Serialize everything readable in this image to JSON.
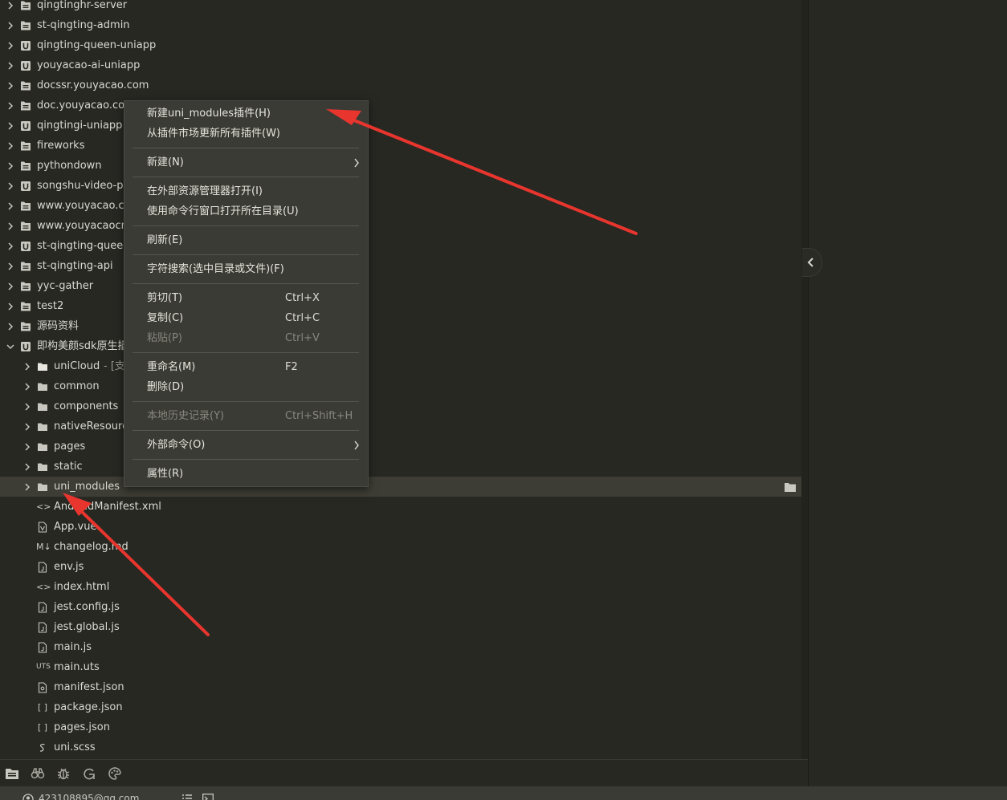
{
  "tree": {
    "items": [
      {
        "label": "qingtinghr-server",
        "icon": "project-icon",
        "level": 0,
        "chevron": "right"
      },
      {
        "label": "st-qingting-admin",
        "icon": "project-icon",
        "level": 0,
        "chevron": "right"
      },
      {
        "label": "qingting-queen-uniapp",
        "icon": "uniapp-project-icon",
        "level": 0,
        "chevron": "right"
      },
      {
        "label": "youyacao-ai-uniapp",
        "icon": "uniapp-project-icon",
        "level": 0,
        "chevron": "right"
      },
      {
        "label": "docssr.youyacao.com",
        "icon": "project-icon",
        "level": 0,
        "chevron": "right"
      },
      {
        "label": "doc.youyacao.com",
        "icon": "project-icon",
        "level": 0,
        "chevron": "right"
      },
      {
        "label": "qingtingi-uniapp",
        "icon": "uniapp-project-icon",
        "level": 0,
        "chevron": "right"
      },
      {
        "label": "fireworks",
        "icon": "project-icon",
        "level": 0,
        "chevron": "right"
      },
      {
        "label": "pythondown",
        "icon": "project-icon",
        "level": 0,
        "chevron": "right"
      },
      {
        "label": "songshu-video-pag",
        "icon": "uniapp-project-icon",
        "level": 0,
        "chevron": "right"
      },
      {
        "label": "www.youyacao.cn_2",
        "icon": "project-icon",
        "level": 0,
        "chevron": "right"
      },
      {
        "label": "www.youyacaocn",
        "icon": "project-icon",
        "level": 0,
        "chevron": "right"
      },
      {
        "label": "st-qingting-queen-",
        "icon": "uniapp-project-icon",
        "level": 0,
        "chevron": "right"
      },
      {
        "label": "st-qingting-api",
        "icon": "project-icon",
        "level": 0,
        "chevron": "right"
      },
      {
        "label": "yyc-gather",
        "icon": "project-icon",
        "level": 0,
        "chevron": "right"
      },
      {
        "label": "test2",
        "icon": "project-icon",
        "level": 0,
        "chevron": "right"
      },
      {
        "label": "源码资料",
        "icon": "project-icon",
        "level": 0,
        "chevron": "right"
      },
      {
        "label": "即构美颜sdk原生插件",
        "icon": "uniapp-project-icon",
        "level": 0,
        "chevron": "down"
      },
      {
        "label": "uniCloud",
        "sub": " - [支付",
        "icon": "cloud-folder-icon",
        "level": 1,
        "chevron": "right"
      },
      {
        "label": "common",
        "icon": "folder-icon",
        "level": 1,
        "chevron": "right"
      },
      {
        "label": "components",
        "icon": "folder-icon",
        "level": 1,
        "chevron": "right"
      },
      {
        "label": "nativeResource",
        "icon": "folder-icon",
        "level": 1,
        "chevron": "right"
      },
      {
        "label": "pages",
        "icon": "folder-icon",
        "level": 1,
        "chevron": "right"
      },
      {
        "label": "static",
        "icon": "folder-icon",
        "level": 1,
        "chevron": "right"
      },
      {
        "label": "uni_modules",
        "icon": "folder-icon",
        "level": 1,
        "chevron": "right",
        "selected": true
      },
      {
        "label": "AndroidManifest.xml",
        "icon": "code-file-icon",
        "level": 1
      },
      {
        "label": "App.vue",
        "icon": "vue-file-icon",
        "level": 1
      },
      {
        "label": "changelog.md",
        "icon": "markdown-file-icon",
        "level": 1
      },
      {
        "label": "env.js",
        "icon": "js-file-icon",
        "level": 1
      },
      {
        "label": "index.html",
        "icon": "code-file-icon",
        "level": 1
      },
      {
        "label": "jest.config.js",
        "icon": "js-file-icon",
        "level": 1
      },
      {
        "label": "jest.global.js",
        "icon": "js-file-icon",
        "level": 1
      },
      {
        "label": "main.js",
        "icon": "js-file-icon",
        "level": 1
      },
      {
        "label": "main.uts",
        "icon": "uts-file-icon",
        "level": 1
      },
      {
        "label": "manifest.json",
        "icon": "manifest-file-icon",
        "level": 1
      },
      {
        "label": "package.json",
        "icon": "json-file-icon",
        "level": 1
      },
      {
        "label": "pages.json",
        "icon": "json-file-icon",
        "level": 1
      },
      {
        "label": "uni.scss",
        "icon": "scss-file-icon",
        "level": 1
      }
    ],
    "uts_glyph": "UTS",
    "json_glyph": "[ ]",
    "code_glyph": "<>",
    "md_glyph": "M↓"
  },
  "context_menu": {
    "items": [
      {
        "type": "item",
        "label": "新建uni_modules插件(H)",
        "name": "menu-new-uni-modules-plugin"
      },
      {
        "type": "item",
        "label": "从插件市场更新所有插件(W)",
        "name": "menu-update-all-plugins"
      },
      {
        "type": "sep"
      },
      {
        "type": "item",
        "label": "新建(N)",
        "name": "menu-new",
        "submenu": true
      },
      {
        "type": "sep"
      },
      {
        "type": "item",
        "label": "在外部资源管理器打开(I)",
        "name": "menu-open-in-explorer"
      },
      {
        "type": "item",
        "label": "使用命令行窗口打开所在目录(U)",
        "name": "menu-open-in-terminal"
      },
      {
        "type": "sep"
      },
      {
        "type": "item",
        "label": "刷新(E)",
        "name": "menu-refresh"
      },
      {
        "type": "sep"
      },
      {
        "type": "item",
        "label": "字符搜索(选中目录或文件)(F)",
        "name": "menu-text-search"
      },
      {
        "type": "sep"
      },
      {
        "type": "item",
        "label": "剪切(T)",
        "shortcut": "Ctrl+X",
        "name": "menu-cut"
      },
      {
        "type": "item",
        "label": "复制(C)",
        "shortcut": "Ctrl+C",
        "name": "menu-copy"
      },
      {
        "type": "item",
        "label": "粘贴(P)",
        "shortcut": "Ctrl+V",
        "name": "menu-paste",
        "disabled": true
      },
      {
        "type": "sep"
      },
      {
        "type": "item",
        "label": "重命名(M)",
        "shortcut": "F2",
        "name": "menu-rename"
      },
      {
        "type": "item",
        "label": "删除(D)",
        "name": "menu-delete"
      },
      {
        "type": "sep"
      },
      {
        "type": "item",
        "label": "本地历史记录(Y)",
        "shortcut": "Ctrl+Shift+H",
        "name": "menu-local-history",
        "disabled": true
      },
      {
        "type": "sep"
      },
      {
        "type": "item",
        "label": "外部命令(O)",
        "name": "menu-external-commands",
        "submenu": true
      },
      {
        "type": "sep"
      },
      {
        "type": "item",
        "label": "属性(R)",
        "name": "menu-properties"
      }
    ]
  },
  "status": {
    "account": "423108895@qq.com"
  },
  "toolbar": {
    "icons": [
      "project-explorer-icon",
      "binoculars-icon",
      "bug-icon",
      "git-icon",
      "palette-icon"
    ]
  },
  "colors": {
    "background": "#272822",
    "menu_bg": "#3b3b35",
    "annotation_arrow": "#e8352e"
  }
}
